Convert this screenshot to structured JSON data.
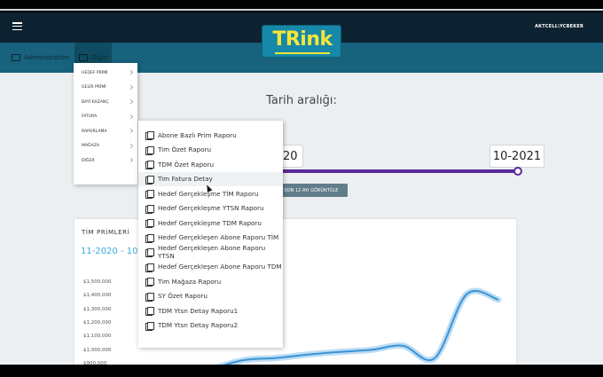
{
  "header": {
    "logo_text": "TRink",
    "user": "AKTCELL\\YCBEKER"
  },
  "nav": {
    "admin_label": "Administration",
    "diger_label": "Diğer"
  },
  "date_range": {
    "title": "Tarih aralığı:",
    "from_value": "20",
    "to_value": "10-2021",
    "show_button": "SON 12 AYI GÖRÜNTÜLE"
  },
  "card": {
    "title": "TİM PRİMLERİ",
    "range": "11-2020 - 10-20"
  },
  "menu1": {
    "items": [
      "HEDEF PRİMİ",
      "GELİR PRİMİ",
      "BAYİ KAZANÇ",
      "FATURA",
      "RAPORLAMA",
      "MAĞAZA",
      "DİĞER"
    ]
  },
  "menu2": {
    "items": [
      "Abone Bazlı Prim Raporu",
      "Tim Özet Raporu",
      "TDM Özet Raporu",
      "Tim Fatura Detay",
      "Hedef Gerçekleşme TİM Raporu",
      "Hedef Gerçekleşme YTSN Raporu",
      "Hedef Gerçekleşme TDM Raporu",
      "Hedef Gerçekleşen Abone Raporu TİM",
      "Hedef Gerçekleşen Abone Raporu YTSN",
      "Hedef Gerçekleşen Abone Raporu TDM",
      "Tim Mağaza Raporu",
      "SY Özet Raporu",
      "TDM Ytsn Detay Raporu1",
      "TDM Ytsn Detay Raporu2"
    ],
    "active_index": 3
  },
  "colors": {
    "header": "#0c2230",
    "navbar": "#18627d",
    "accent": "#5b2a96",
    "line": "#3a93d8",
    "logo_bg": "#1688a8",
    "logo_text": "#f6e53a"
  },
  "chart_data": {
    "type": "line",
    "title": "TİM PRİMLERİ",
    "subtitle": "11-2020 - 10-20",
    "xlabel": "",
    "ylabel": "",
    "ylim": [
      800000,
      1500000
    ],
    "y_ticks": [
      "$1,500,000",
      "$1,400,000",
      "$1,300,000",
      "$1,200,000",
      "$1,100,000",
      "$1,000,000",
      "$900,000",
      "$800,000"
    ],
    "grid": false,
    "series": [
      {
        "values": [
          850000,
          845000,
          775000,
          860000,
          925000,
          940000,
          965000,
          985000,
          1000000,
          1030000,
          940000,
          1410000,
          1370000
        ]
      }
    ]
  }
}
